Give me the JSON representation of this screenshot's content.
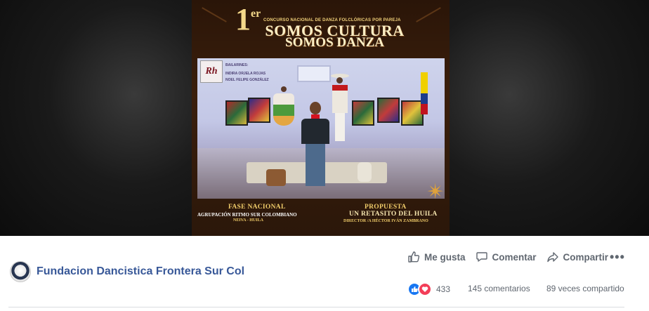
{
  "video": {
    "edition_number": "1",
    "edition_suffix": "er",
    "contest_name": "CONCURSO NACIONAL DE DANZA FOLCLÓRICAS POR PAREJA",
    "title_line1": "SOMOS CULTURA",
    "title_line2": "SOMOS DANZA",
    "logo_text": "Rh",
    "dancers_heading": "BAILARINES:",
    "dancer_1": "INDIRA ORJELA ROJAS",
    "dancer_2": "NOEL FELIPE GONZÁLEZ",
    "phase_title": "FASE NACIONAL",
    "group_name": "AGRUPACIÓN RITMO SUR COLOMBIANO",
    "group_location": "NEIVA - HUILA",
    "proposal_title": "PROPUESTA",
    "proposal_name": "UN RETASITO DEL HUILA",
    "director": "DIRECTOR /A HÉCTOR IVÁN ZAMBRANO"
  },
  "actions": {
    "like_label": "Me gusta",
    "comment_label": "Comentar",
    "share_label": "Compartir",
    "more_label": "•••"
  },
  "page": {
    "name": "Fundacion Dancistica Frontera Sur Col"
  },
  "stats": {
    "reactions_count": "433",
    "comments": "145 comentarios",
    "shares": "89 veces compartido"
  },
  "colors": {
    "link": "#385898",
    "muted": "#606770",
    "like": "#1877f2",
    "love": "#f33e58"
  }
}
